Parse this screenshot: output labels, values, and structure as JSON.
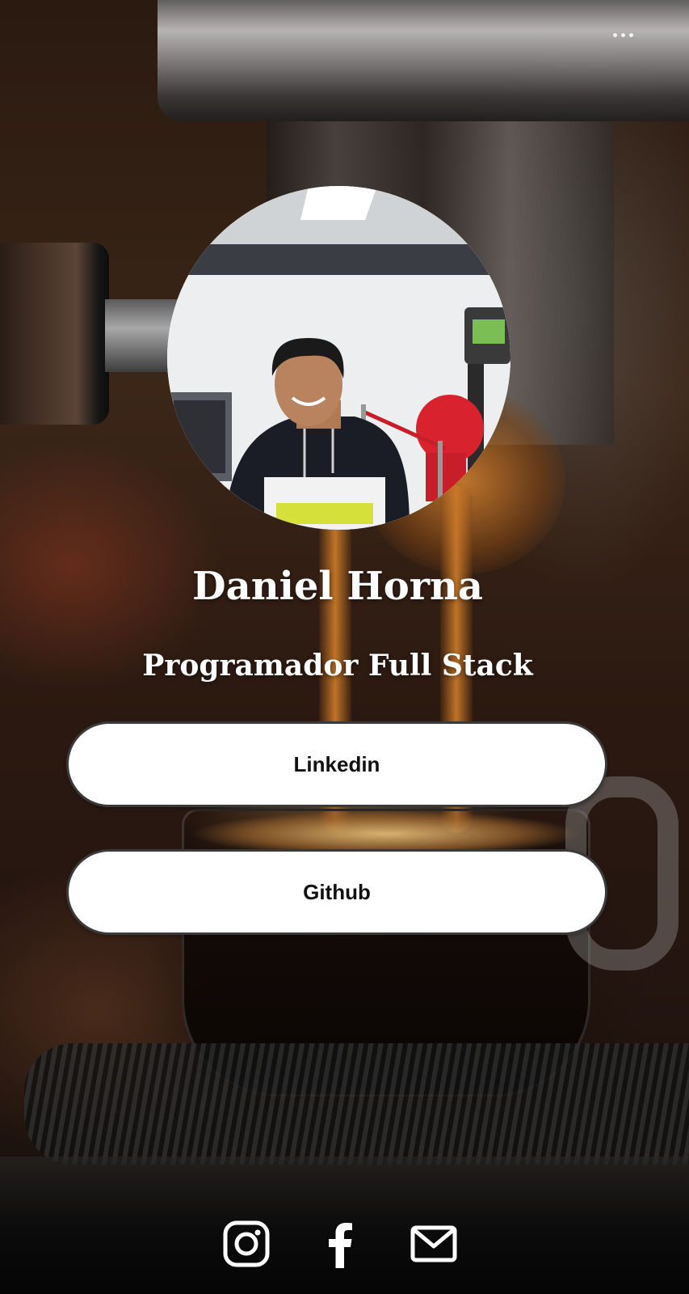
{
  "profile": {
    "name": "Daniel Horna",
    "title": "Programador Full Stack"
  },
  "links": [
    {
      "label": "Linkedin"
    },
    {
      "label": "Github"
    }
  ],
  "menu": {
    "icon": "more-horizontal-icon"
  },
  "social": [
    {
      "icon": "instagram-icon"
    },
    {
      "icon": "facebook-icon"
    },
    {
      "icon": "mail-icon"
    }
  ],
  "colors": {
    "button_background": "#ffffff",
    "button_border": "#3a3a3a",
    "text_light": "#ffffff",
    "espresso": "#c27a2c"
  }
}
